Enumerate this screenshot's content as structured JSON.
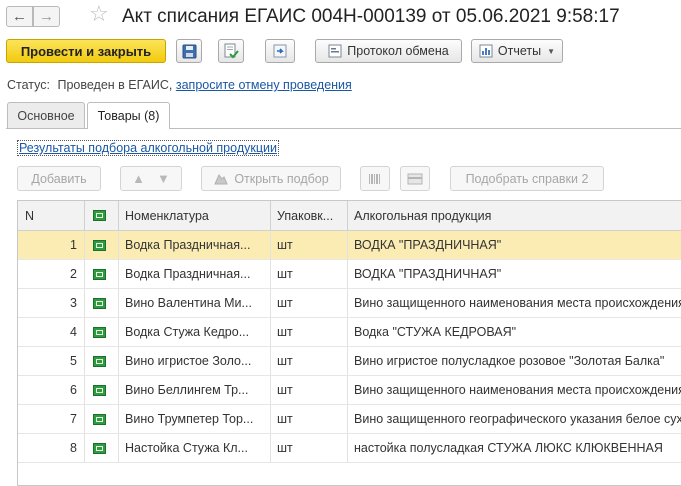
{
  "title": "Акт списания ЕГАИС 004Н-000139 от 05.06.2021 9:58:17",
  "nav": {
    "back": "←",
    "forward": "→",
    "star": "☆"
  },
  "toolbar": {
    "post_close": "Провести и закрыть",
    "exchange_protocol": "Протокол обмена",
    "reports": "Отчеты"
  },
  "status": {
    "label": "Статус:",
    "value": "Проведен в ЕГАИС,",
    "link": "запросите отмену проведения"
  },
  "tabs": [
    {
      "label": "Основное",
      "active": false
    },
    {
      "label": "Товары (8)",
      "active": true
    }
  ],
  "results_link": "Результаты подбора алкогольной продукции",
  "table_toolbar": {
    "add": "Добавить",
    "open_selection": "Открыть подбор",
    "select_certs": "Подобрать справки 2"
  },
  "table": {
    "columns": [
      "N",
      "",
      "Номенклатура",
      "Упаковк...",
      "Алкогольная продукция"
    ],
    "rows": [
      {
        "n": "1",
        "nomenclature": "Водка Праздничная...",
        "pack": "шт",
        "product": "ВОДКА \"ПРАЗДНИЧНАЯ\"",
        "selected": true
      },
      {
        "n": "2",
        "nomenclature": "Водка Праздничная...",
        "pack": "шт",
        "product": "ВОДКА \"ПРАЗДНИЧНАЯ\"",
        "selected": false
      },
      {
        "n": "3",
        "nomenclature": "Вино Валентина Ми...",
        "pack": "шт",
        "product": "Вино защищенного наименования места происхождения",
        "selected": false
      },
      {
        "n": "4",
        "nomenclature": "Водка Стужа Кедро...",
        "pack": "шт",
        "product": "Водка \"СТУЖА КЕДРОВАЯ\"",
        "selected": false
      },
      {
        "n": "5",
        "nomenclature": "Вино игристое Золо...",
        "pack": "шт",
        "product": "Вино игристое полусладкое розовое \"Золотая Балка\"",
        "selected": false
      },
      {
        "n": "6",
        "nomenclature": "Вино Беллингем Тр...",
        "pack": "шт",
        "product": "Вино защищенного наименования места происхождения",
        "selected": false
      },
      {
        "n": "7",
        "nomenclature": "Вино Трумпетер Тор...",
        "pack": "шт",
        "product": "Вино защищенного географического указания белое сухое",
        "selected": false
      },
      {
        "n": "8",
        "nomenclature": "Настойка Стужа Кл...",
        "pack": "шт",
        "product": "настойка полусладкая СТУЖА ЛЮКС КЛЮКВЕННАЯ",
        "selected": false
      }
    ]
  },
  "colors": {
    "primary": "#f2cb0e",
    "selected_row": "#fbecb4",
    "link": "#1a57a6"
  }
}
